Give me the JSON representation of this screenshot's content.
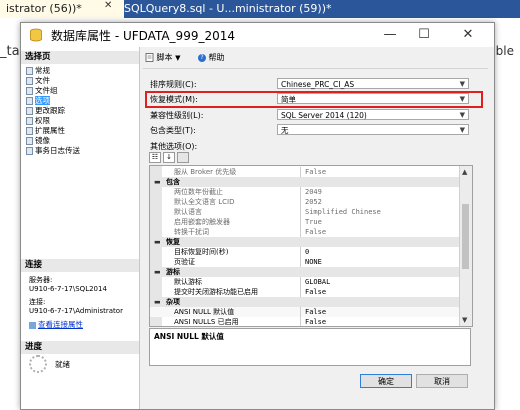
{
  "background": {
    "active_tab": "istrator (56))*",
    "other_tab": "SQLQuery8.sql - U...ministrator (59))*",
    "left_editor_text": "_ta",
    "right_editor_text": "ble"
  },
  "window": {
    "title": "数据库属性 - UFDATA_999_2014",
    "minimize": "—",
    "maximize": "☐",
    "close": "✕"
  },
  "left_panel": {
    "pages_header": "选择页",
    "pages": [
      "常规",
      "文件",
      "文件组",
      "选项",
      "更改跟踪",
      "权限",
      "扩展属性",
      "镜像",
      "事务日志传送"
    ],
    "selected_page": "选项",
    "connection_header": "连接",
    "server_label": "服务器:",
    "server_value": "U910-6-7-17\\SQL2014",
    "connection_label": "连接:",
    "connection_value": "U910-6-7-17\\Administrator",
    "view_connection_link": "查看连接属性",
    "progress_header": "进度",
    "progress_status": "就绪"
  },
  "toolbar": {
    "script_label": "脚本",
    "help_label": "帮助"
  },
  "fields": {
    "collation_label": "排序规则(C):",
    "collation_value": "Chinese_PRC_CI_AS",
    "recovery_label": "恢复模式(M):",
    "recovery_value": "简单",
    "compat_label": "兼容性级别(L):",
    "compat_value": "SQL Server 2014 (120)",
    "containment_label": "包含类型(T):",
    "containment_value": "无",
    "other_options_label": "其他选项(O):"
  },
  "grid_rows": [
    {
      "kind": "prop",
      "label": "服从 Broker 优先级",
      "value": "False",
      "editable": false
    },
    {
      "kind": "cat",
      "label": "包含"
    },
    {
      "kind": "prop",
      "label": "两位数年份截止",
      "value": "2049",
      "editable": false
    },
    {
      "kind": "prop",
      "label": "默认全文语言 LCID",
      "value": "2052",
      "editable": false
    },
    {
      "kind": "prop",
      "label": "默认语言",
      "value": "Simplified Chinese",
      "editable": false
    },
    {
      "kind": "prop",
      "label": "启用嵌套的触发器",
      "value": "True",
      "editable": false
    },
    {
      "kind": "prop",
      "label": "转换干扰词",
      "value": "False",
      "editable": false
    },
    {
      "kind": "cat",
      "label": "恢复"
    },
    {
      "kind": "prop",
      "label": "目标恢复时间(秒)",
      "value": "0",
      "editable": true
    },
    {
      "kind": "prop",
      "label": "页验证",
      "value": "NONE",
      "editable": true
    },
    {
      "kind": "cat",
      "label": "游标"
    },
    {
      "kind": "prop",
      "label": "默认游标",
      "value": "GLOBAL",
      "editable": true
    },
    {
      "kind": "prop",
      "label": "提交时关闭游标功能已启用",
      "value": "False",
      "editable": true
    },
    {
      "kind": "cat",
      "label": "杂项"
    },
    {
      "kind": "prop",
      "label": "ANSI NULL 默认值",
      "value": "False",
      "editable": true
    },
    {
      "kind": "prop",
      "label": "ANSI NULLS 已启用",
      "value": "False",
      "editable": true
    }
  ],
  "description": "ANSI NULL 默认值",
  "buttons": {
    "ok": "确定",
    "cancel": "取消"
  },
  "colors": {
    "highlight_border": "#e0201f",
    "selected_page": "#3399ff",
    "tab_bar": "#2b579a"
  }
}
